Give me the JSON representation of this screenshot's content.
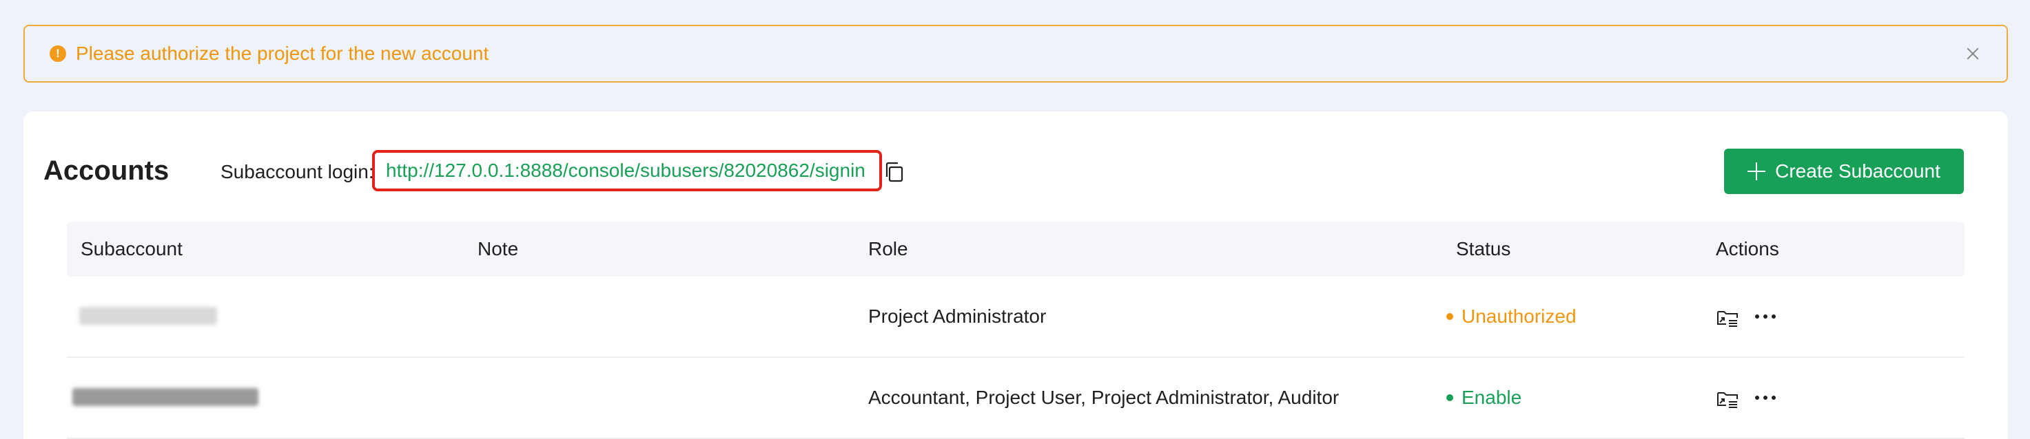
{
  "alert": {
    "message": "Please authorize the project for the new account",
    "color": "#f0960e"
  },
  "header": {
    "title": "Accounts",
    "login_label": "Subaccount login:",
    "login_url": "http://127.0.0.1:8888/console/subusers/82020862/signin",
    "create_button_label": "Create Subaccount"
  },
  "table": {
    "columns": [
      "Subaccount",
      "Note",
      "Role",
      "Status",
      "Actions"
    ],
    "rows": [
      {
        "subaccount": "",
        "note": "",
        "role": "Project Administrator",
        "status": "Unauthorized",
        "status_color": "#f0960e"
      },
      {
        "subaccount": "",
        "note": "",
        "role": "Accountant, Project User, Project Administrator, Auditor",
        "status": "Enable",
        "status_color": "#18a058"
      }
    ]
  },
  "colors": {
    "accent": "#18a058",
    "warning": "#f0960e",
    "highlight_border": "#e3231a"
  },
  "icons": {
    "alert": "exclamation-circle-icon",
    "close": "close-icon",
    "copy": "copy-icon",
    "create": "plus-icon",
    "row_action": "assign-project-icon",
    "row_more": "more-icon"
  }
}
